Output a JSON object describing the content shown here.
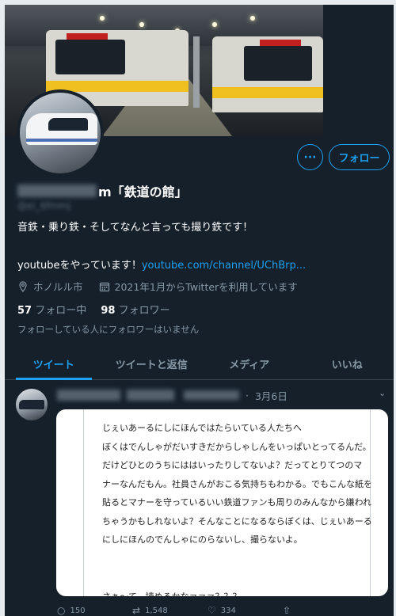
{
  "profile": {
    "name_suffix": "m「鉄道の館」",
    "handle": "@ei_6fmmj",
    "bio_line1": "音鉄・乗り鉄・そしてなんと言っても撮り鉄です！",
    "bio_line2_text": "youtubeをやっています！",
    "bio_line2_link": "youtube.com/channel/UChBrp...",
    "location": "ホノルル市",
    "joined": "2021年1月からTwitterを利用しています",
    "following_count": "57",
    "following_label": "フォロー中",
    "followers_count": "98",
    "followers_label": "フォロワー",
    "mutual_note": "フォローしている人にフォロワーはいません"
  },
  "buttons": {
    "more": "···",
    "follow": "フォロー"
  },
  "tabs": [
    {
      "label": "ツイート"
    },
    {
      "label": "ツイートと返信"
    },
    {
      "label": "メディア"
    },
    {
      "label": "いいね"
    }
  ],
  "tweet": {
    "date": "3月6日",
    "image_lines": [
      "じぇいあーるにしにほんではたらいている人たちへ",
      "ぼくはでんしゃがだいすきだからしゃしんをいっぱいとってるんだ。",
      "だけどひとのうちにははいったりしてないよ？だってとりてつのマ",
      "ナーなんだもん。社員さんがおこる気持ちもわかる。でもこんな紙を",
      "貼るとマナーを守っているいい鉄道ファンも周りのみんなから嫌われ",
      "ちゃうかもしれないよ？そんなことになるならぼくは、じぇいあーる",
      "にしにほんのでんしゃにのらないし、撮らないよ。"
    ],
    "image_last_line": "さぁ〜て、読めるかなァァァ？？？",
    "replies": "150",
    "retweets": "1,548",
    "likes": "334"
  },
  "colors": {
    "background": "#15202b",
    "accent": "#1da1f2",
    "secondary_text": "#8899a6"
  }
}
